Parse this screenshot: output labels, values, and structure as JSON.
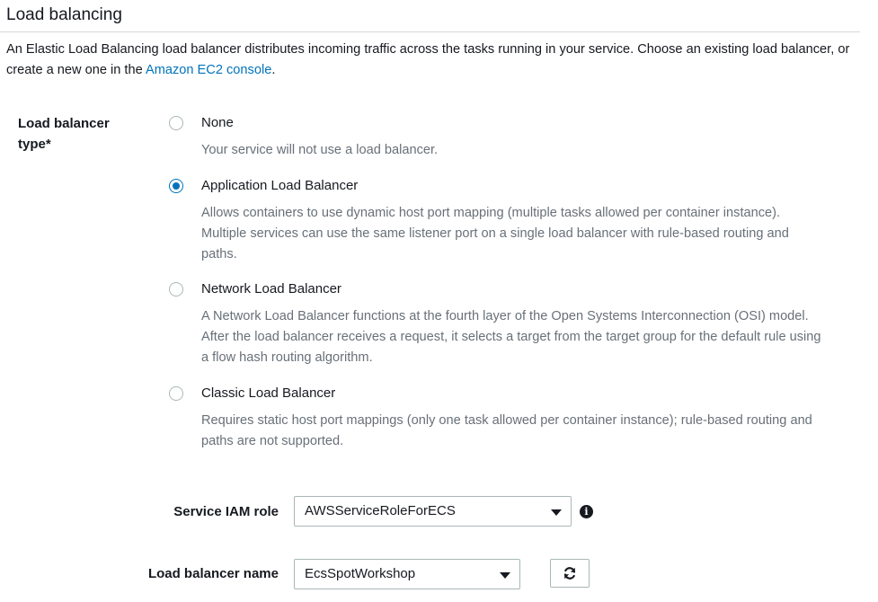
{
  "section": {
    "title": "Load balancing",
    "intro_text": "An Elastic Load Balancing load balancer distributes incoming traffic across the tasks running in your service. Choose an existing load balancer, or create a new one in the ",
    "intro_link": "Amazon EC2 console",
    "intro_end": "."
  },
  "lb_type": {
    "label": "Load balancer type*",
    "options": [
      {
        "label": "None",
        "description": "Your service will not use a load balancer.",
        "selected": false
      },
      {
        "label": "Application Load Balancer",
        "description": "Allows containers to use dynamic host port mapping (multiple tasks allowed per container instance). Multiple services can use the same listener port on a single load balancer with rule-based routing and paths.",
        "selected": true
      },
      {
        "label": "Network Load Balancer",
        "description": "A Network Load Balancer functions at the fourth layer of the Open Systems Interconnection (OSI) model. After the load balancer receives a request, it selects a target from the target group for the default rule using a flow hash routing algorithm.",
        "selected": false
      },
      {
        "label": "Classic Load Balancer",
        "description": "Requires static host port mappings (only one task allowed per container instance); rule-based routing and paths are not supported.",
        "selected": false
      }
    ]
  },
  "iam_role": {
    "label": "Service IAM role",
    "value": "AWSServiceRoleForECS",
    "icon": "info-icon"
  },
  "lb_name": {
    "label": "Load balancer name",
    "value": "EcsSpotWorkshop",
    "icon": "refresh-icon"
  },
  "colors": {
    "accent": "#0073bb",
    "muted_text": "#687078",
    "border": "#aab7b8"
  }
}
